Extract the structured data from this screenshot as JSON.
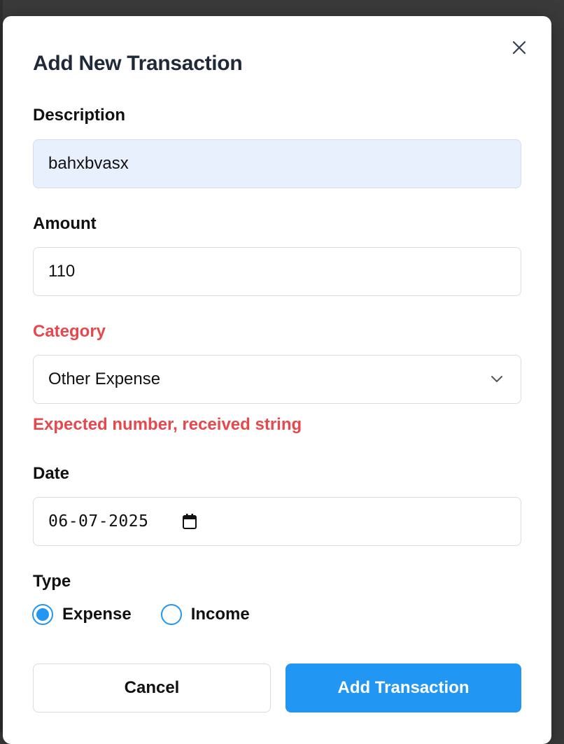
{
  "modal": {
    "title": "Add New Transaction",
    "close_icon": "close-icon"
  },
  "form": {
    "description": {
      "label": "Description",
      "value": "bahxbvasx"
    },
    "amount": {
      "label": "Amount",
      "value": "110"
    },
    "category": {
      "label": "Category",
      "selected": "Other Expense",
      "error": "Expected number, received string",
      "icon": "chevron-down-icon"
    },
    "date": {
      "label": "Date",
      "value": "06-07-2025",
      "icon": "calendar-icon"
    },
    "type": {
      "label": "Type",
      "options": [
        {
          "label": "Expense",
          "selected": true
        },
        {
          "label": "Income",
          "selected": false
        }
      ]
    }
  },
  "actions": {
    "cancel_label": "Cancel",
    "submit_label": "Add Transaction"
  },
  "colors": {
    "accent": "#2196f3",
    "error": "#e5484d",
    "filled_input_bg": "#e9f0fd"
  }
}
